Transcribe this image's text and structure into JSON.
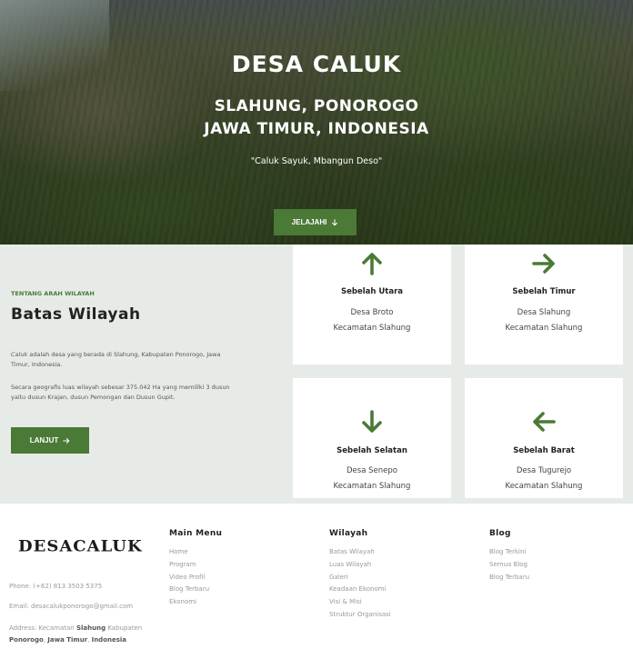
{
  "hero": {
    "title": "DESA CALUK",
    "subtitle_line1": "SLAHUNG, PONOROGO",
    "subtitle_line2": "JAWA TIMUR, INDONESIA",
    "tagline": "\"Caluk Sayuk, Mbangun Deso\"",
    "cta_label": "JELAJAHI",
    "cta_icon": "arrow-down-icon"
  },
  "about": {
    "eyebrow": "TENTANG ARAH WILAYAH",
    "title": "Batas Wilayah",
    "p1_em": "Caluk",
    "p1_rest": " adalah desa yang berada di Slahung, Kabupaten Ponorogo, Jawa Timur, Indonesia.",
    "p2": "Secara geografis luas wilayah sebesar 375.042 Ha yang memiliki 3 dusun yaitu dusun Krajan, dusun Pemongan dan Dusun Gupit.",
    "cta_label": "LANJUT",
    "cta_icon": "arrow-right-icon"
  },
  "cards": [
    {
      "title": "Sebelah Utara",
      "line1": "Desa Broto",
      "line2": "Kecamatan Slahung",
      "icon": "arrow-up-icon"
    },
    {
      "title": "Sebelah Timur",
      "line1": "Desa Slahung",
      "line2": "Kecamatan Slahung",
      "icon": "arrow-right-icon"
    },
    {
      "title": "Sebelah Selatan",
      "line1": "Desa Senepo",
      "line2": "Kecamatan Slahung",
      "icon": "arrow-down-icon"
    },
    {
      "title": "Sebelah Barat",
      "line1": "Desa Tugurejo",
      "line2": "Kecamatan Slahung",
      "icon": "arrow-left-icon"
    }
  ],
  "footer": {
    "logo": "DESACALUK",
    "phone": "Phone: (+62) 813 3503 5375",
    "email": "Email: desacalukponorogo@gmail.com",
    "address_prefix": "Address: Kecamatan ",
    "address_b1": "Slahung",
    "address_mid1": " Kabupaten ",
    "address_b2": "Ponorogo",
    "address_mid2": ", ",
    "address_b3": "Jawa Timur",
    "address_mid3": ", ",
    "address_b4": "Indonesia",
    "main_menu": {
      "heading": "Main Menu",
      "items": [
        "Home",
        "Program",
        "Video Profil",
        "Blog Terbaru",
        "Ekonomi"
      ]
    },
    "wilayah": {
      "heading": "Wilayah",
      "items": [
        "Batas Wilayah",
        "Luas Wilayah",
        "Galeri",
        "Keadaan Ekonomi",
        "Visi & Misi",
        "Struktur Organisasi"
      ]
    },
    "blog": {
      "heading": "Blog",
      "items": [
        "Blog Terkini",
        "Semua Blog",
        "Blog Terbaru"
      ]
    }
  },
  "colors": {
    "accent": "#4a7a35",
    "section_bg": "#e7ebe7"
  }
}
